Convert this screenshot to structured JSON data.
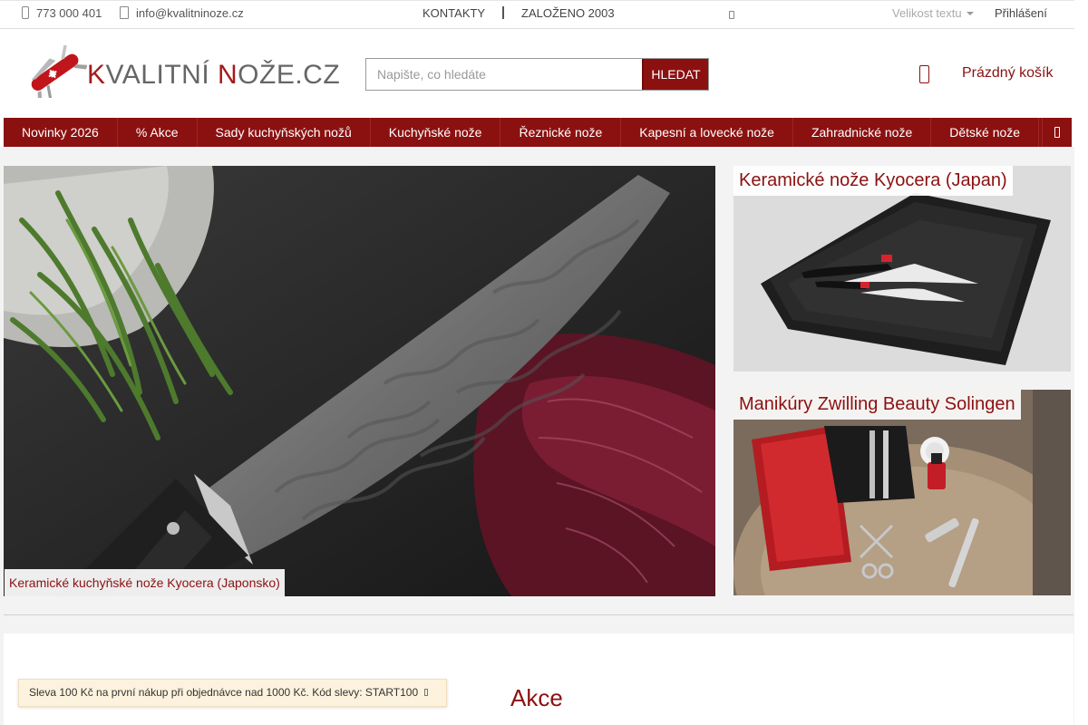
{
  "topbar": {
    "phone": "773 000 401",
    "email": "info@kvalitninoze.cz",
    "contacts": "KONTAKTY",
    "founded": "ZALOŽENO 2003",
    "font_size_label": "Velikost textu",
    "login": "Přihlášení"
  },
  "header": {
    "logo": {
      "part1": "K",
      "part2": "VALITNÍ ",
      "part3": "N",
      "part4": "OŽE.CZ"
    },
    "search": {
      "placeholder": "Napište, co hledáte",
      "button": "HLEDAT"
    },
    "cart": "Prázdný košík"
  },
  "menu": {
    "items": [
      "Novinky 2026",
      "% Akce",
      "Sady kuchyňských nožů",
      "Kuchyňské nože",
      "Řeznické nože",
      "Kapesní a lovecké nože",
      "Zahradnické nože",
      "Dětské nože"
    ]
  },
  "banners": {
    "main_caption": "Keramické kuchyňské nože Kyocera (Japonsko)",
    "right_top_caption": "Keramické nože Kyocera (Japan)",
    "right_bottom_caption": "Manikúry Zwilling Beauty Solingen"
  },
  "section": {
    "title": "Akce"
  },
  "promo": {
    "text": "Sleva 100 Kč na první nákup při objednávce nad 1000 Kč. Kód slevy: START100"
  },
  "colors": {
    "brand_red": "#8b1111",
    "background": "#f3f3f3"
  },
  "icons": [
    "phone-icon",
    "mail-icon",
    "small-icon",
    "cart-icon",
    "menu-more-icon",
    "close-icon"
  ]
}
